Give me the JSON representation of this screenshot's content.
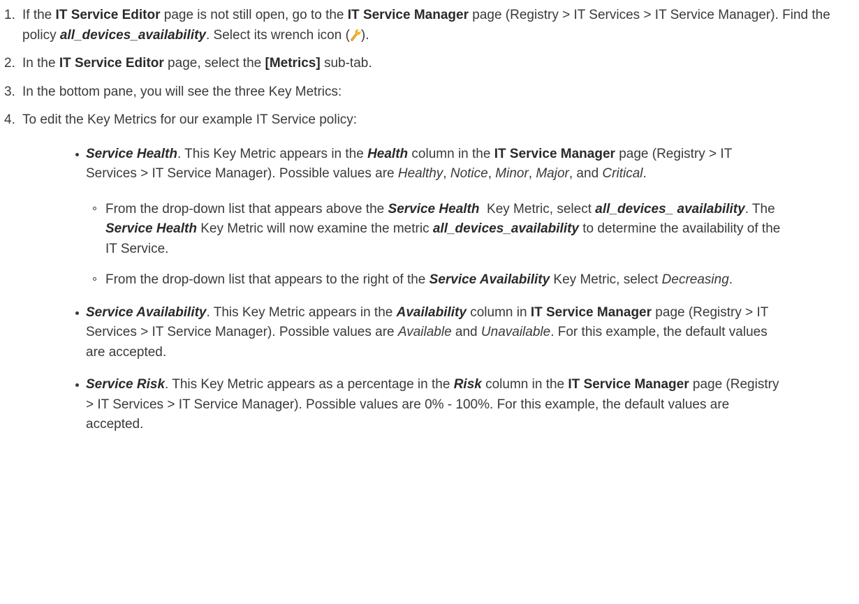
{
  "steps": [
    {
      "num": "1.",
      "t1": "If the ",
      "b1": "IT Service Editor",
      "t2": " page is not still open, go to the ",
      "b2": "IT Service Manager",
      "t3": " page (Registry > IT Services > IT Service Manager). Find the policy ",
      "bi1": "all_devices_availability",
      "t4": ". Select its wrench icon (",
      "t5": ")."
    },
    {
      "num": "2.",
      "t1": "In the ",
      "b1": "IT Service Editor",
      "t2": " page, select the ",
      "b2": "[Metrics]",
      "t3": " sub-tab."
    },
    {
      "num": "3.",
      "t1": "In the bottom pane, you will see the three Key Metrics:"
    },
    {
      "num": "4.",
      "t1": "To edit the Key Metrics for our example IT Service policy:"
    }
  ],
  "bullets": {
    "health": {
      "bi1": "Service Health",
      "t1": ". This Key Metric appears in the ",
      "bi2": "Health",
      "t2": " column in the ",
      "b1": "IT Service Manager",
      "t3": " page (Registry > IT Services > IT Service Manager). Possible values are ",
      "i1": "Healthy",
      "c1": ", ",
      "i2": "Notice",
      "c2": ", ",
      "i3": "Minor",
      "c3": ", ",
      "i4": "Major",
      "c4": ", and ",
      "i5": "Critical",
      "end": ".",
      "sub": [
        {
          "t1": "From the drop-down list that appears above the ",
          "bi1": "Service Health",
          "t2": "  Key Metric, select ",
          "bi2": "all_devices_ availability",
          "t3": ". The ",
          "bi3": "Service Health",
          "t4": " Key Metric will now examine the metric ",
          "bi4": "all_devices_availability",
          "t5": " to determine the availability of the IT Service."
        },
        {
          "t1": "From the drop-down list that appears to the right of the ",
          "bi1": "Service Availability",
          "t2": " Key Metric, select ",
          "i1": "Decreasing",
          "t3": "."
        }
      ]
    },
    "availability": {
      "bi1": "Service Availability",
      "t1": ". This Key Metric appears in the ",
      "bi2": "Availability",
      "t2": " column in ",
      "b1": "IT Service Manager",
      "t3": " page (Registry > IT Services > IT Service Manager). Possible values are ",
      "i1": "Available",
      "t4": " and ",
      "i2": "Unavailable",
      "t5": ". For this example, the default values are accepted."
    },
    "risk": {
      "bi1": "Service Risk",
      "t1": ". This Key Metric appears as a percentage in the ",
      "bi2": "Risk",
      "t2": " column in the ",
      "b1": "IT Service Manager",
      "t3": " page (Registry > IT Services > IT Service Manager). Possible values are 0% - 100%. For this example, the default values are accepted."
    }
  },
  "icons": {
    "wrench": "wrench-icon",
    "wrench_color": "#e8a317"
  }
}
